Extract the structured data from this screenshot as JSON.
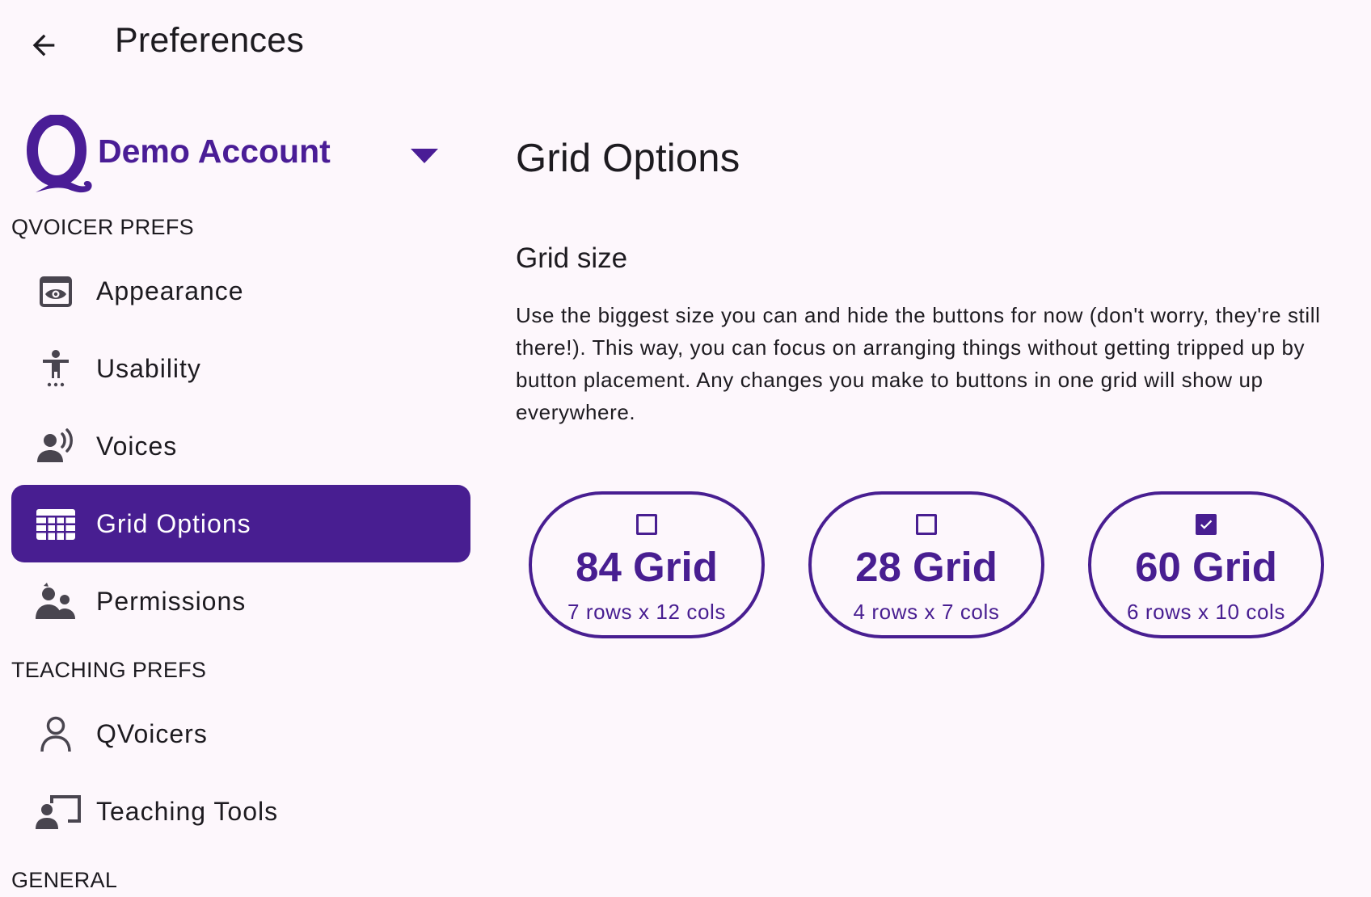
{
  "header": {
    "title": "Preferences"
  },
  "account": {
    "name": "Demo Account"
  },
  "sidebar": {
    "sections": [
      {
        "label": "QVOICER PREFS"
      },
      {
        "label": "TEACHING PREFS"
      },
      {
        "label": "GENERAL"
      }
    ],
    "items": [
      {
        "label": "Appearance",
        "icon": "appearance-icon"
      },
      {
        "label": "Usability",
        "icon": "accessibility-icon"
      },
      {
        "label": "Voices",
        "icon": "voice-icon"
      },
      {
        "label": "Grid Options",
        "icon": "grid-icon",
        "active": true
      },
      {
        "label": "Permissions",
        "icon": "permissions-icon"
      },
      {
        "label": "QVoicers",
        "icon": "person-icon"
      },
      {
        "label": "Teaching Tools",
        "icon": "teaching-icon"
      }
    ]
  },
  "main": {
    "title": "Grid Options",
    "section_title": "Grid size",
    "description": "Use the biggest size you can and hide the buttons for now (don't worry, they're still there!). This way, you can focus on arranging things without getting tripped up by button placement. Any changes you make to buttons in one grid will show up everywhere.",
    "grid_options": [
      {
        "name": "84 Grid",
        "dims": "7 rows x 12 cols",
        "checked": false
      },
      {
        "name": "28 Grid",
        "dims": "4 rows x 7 cols",
        "checked": false
      },
      {
        "name": "60 Grid",
        "dims": "6 rows x 10 cols",
        "checked": true
      }
    ]
  },
  "colors": {
    "accent": "#481e91",
    "background": "#fdf7fc",
    "text": "#1d1b20",
    "icon": "#49454f"
  }
}
